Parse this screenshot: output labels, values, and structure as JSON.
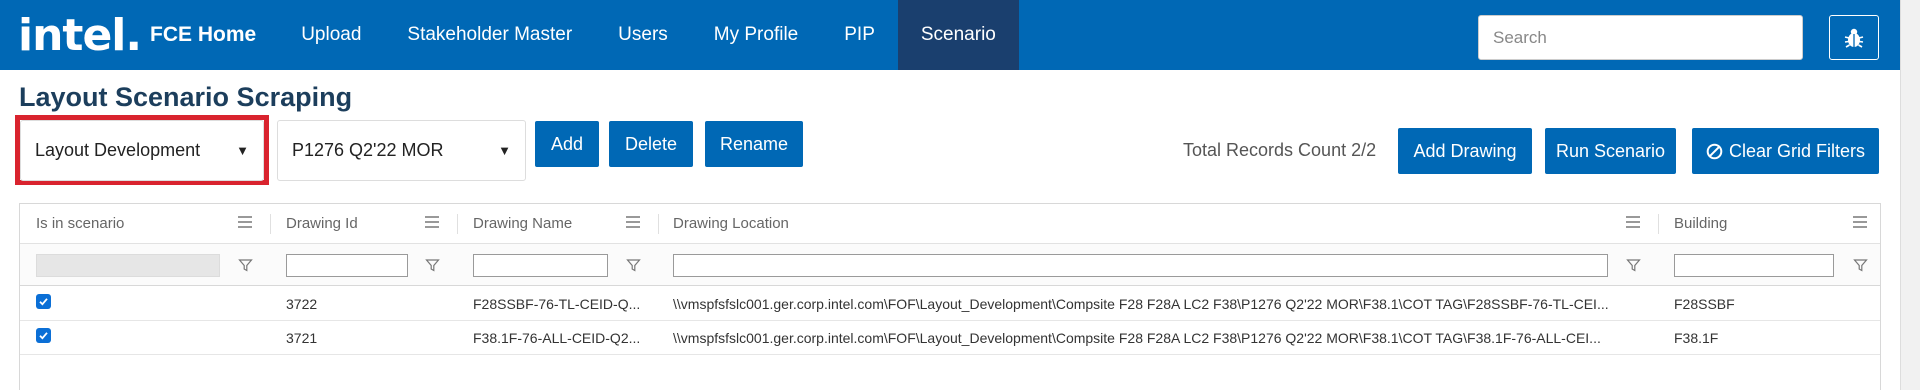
{
  "nav": {
    "logo": "intel.",
    "brand": "FCE Home",
    "items": [
      {
        "label": "Upload"
      },
      {
        "label": "Stakeholder Master"
      },
      {
        "label": "Users"
      },
      {
        "label": "My Profile"
      },
      {
        "label": "PIP"
      },
      {
        "label": "Scenario",
        "active": true
      }
    ],
    "search_placeholder": "Search",
    "bug_icon": "bug-icon"
  },
  "page": {
    "title": "Layout Scenario Scraping"
  },
  "toolbar": {
    "category_select": "Layout Development",
    "scenario_select": "P1276 Q2'22 MOR",
    "add_label": "Add",
    "delete_label": "Delete",
    "rename_label": "Rename",
    "records_count": "Total Records Count 2/2",
    "add_drawing_label": "Add Drawing",
    "run_scenario_label": "Run Scenario",
    "clear_filters_label": "Clear Grid Filters",
    "clear_filters_icon": "ban-icon"
  },
  "grid": {
    "columns": [
      {
        "label": "Is in scenario"
      },
      {
        "label": "Drawing Id"
      },
      {
        "label": "Drawing Name"
      },
      {
        "label": "Drawing Location"
      },
      {
        "label": "Building"
      }
    ],
    "rows": [
      {
        "checked": true,
        "drawing_id": "3722",
        "drawing_name": "F28SSBF-76-TL-CEID-Q...",
        "drawing_location": "\\\\vmspfsfslc001.ger.corp.intel.com\\FOF\\Layout_Development\\Compsite F28 F28A LC2 F38\\P1276 Q2'22 MOR\\F38.1\\COT TAG\\F28SSBF-76-TL-CEI...",
        "building": "F28SSBF"
      },
      {
        "checked": true,
        "drawing_id": "3721",
        "drawing_name": "F38.1F-76-ALL-CEID-Q2...",
        "drawing_location": "\\\\vmspfsfslc001.ger.corp.intel.com\\FOF\\Layout_Development\\Compsite F28 F28A LC2 F38\\P1276 Q2'22 MOR\\F38.1\\COT TAG\\F38.1F-76-ALL-CEI...",
        "building": "F38.1F"
      }
    ]
  },
  "colors": {
    "nav_bg": "#0068b5",
    "nav_active": "#1a3f6e",
    "button": "#0068b5",
    "highlight": "#d9232e",
    "title": "#1c3e5c"
  }
}
